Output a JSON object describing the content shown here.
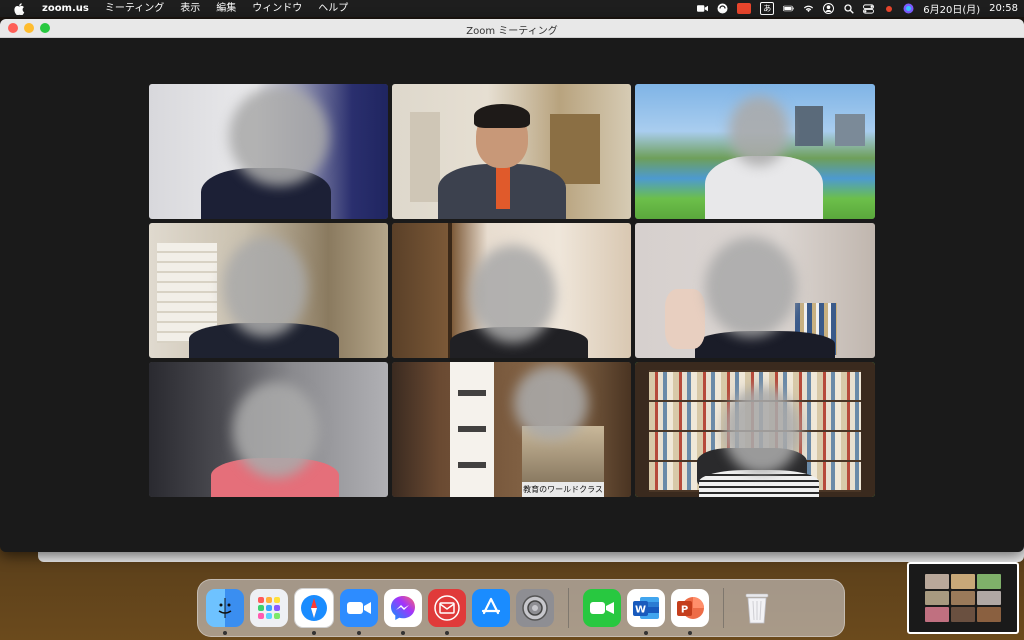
{
  "menubar": {
    "app_name": "zoom.us",
    "items": [
      "ミーティング",
      "表示",
      "編集",
      "ウィンドウ",
      "ヘルプ"
    ],
    "tray_a": "あ",
    "date": "6月20日(月)",
    "time": "20:58"
  },
  "window": {
    "title": "Zoom ミーティング"
  },
  "participants": [
    {
      "id": 1,
      "active": false
    },
    {
      "id": 2,
      "active": false
    },
    {
      "id": 3,
      "active": false
    },
    {
      "id": 4,
      "active": false
    },
    {
      "id": 5,
      "active": false
    },
    {
      "id": 6,
      "active": false
    },
    {
      "id": 7,
      "active": false
    },
    {
      "id": 8,
      "active": false,
      "poster_caption": "教育のワールドクラス"
    },
    {
      "id": 9,
      "active": true
    }
  ],
  "dock": {
    "apps": [
      "finder-icon",
      "launchpad-icon",
      "safari-icon",
      "zoom-icon",
      "messenger-icon",
      "mail-icon",
      "app-store-icon",
      "system-settings-icon",
      "facetime-icon",
      "word-icon",
      "powerpoint-icon",
      "trash-icon"
    ]
  },
  "colors": {
    "active_speaker_border": "#37d34b",
    "window_bg": "#1a1a1a",
    "zoom_blue": "#2d8cff"
  }
}
